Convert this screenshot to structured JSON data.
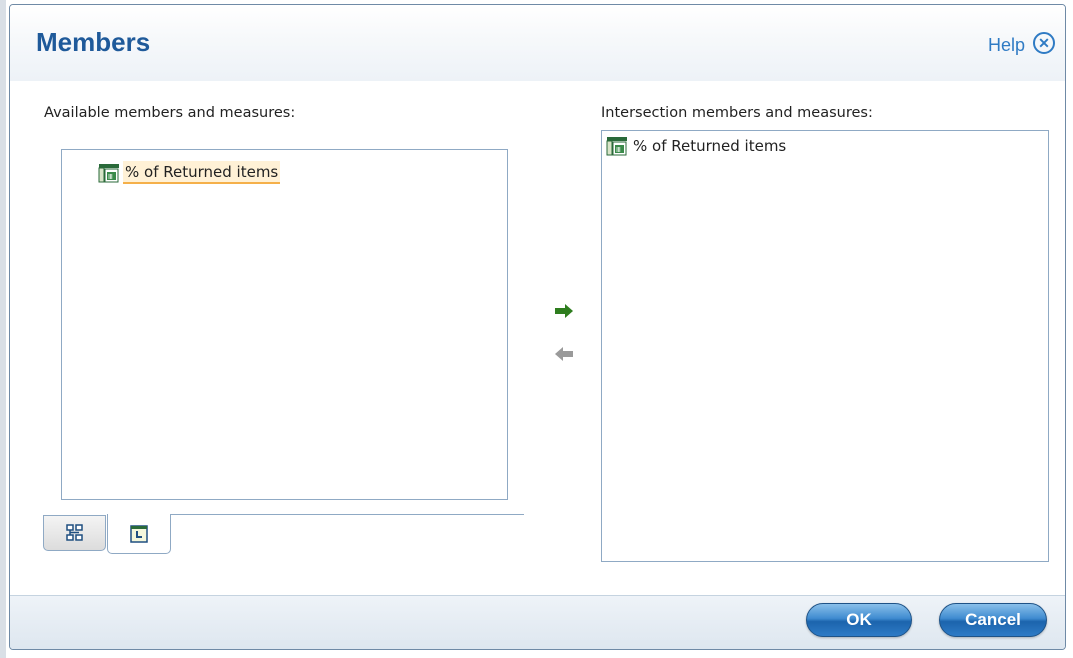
{
  "dialog": {
    "title": "Members",
    "help_label": "Help",
    "close_glyph": "✕"
  },
  "available": {
    "label": "Available members and measures:",
    "items": [
      {
        "label": "% of Returned items",
        "icon": "measure-icon",
        "selected": true
      }
    ]
  },
  "intersection": {
    "label": "Intersection members and measures:",
    "items": [
      {
        "label": "% of Returned items",
        "icon": "measure-icon"
      }
    ]
  },
  "transfer": {
    "add_icon": "arrow-right-icon",
    "remove_icon": "arrow-left-icon",
    "add_color": "#2e7d1e",
    "remove_color": "#9a9a9a"
  },
  "tabs": [
    {
      "icon": "hierarchy-icon",
      "active": false
    },
    {
      "icon": "measure-list-icon",
      "active": true
    }
  ],
  "buttons": {
    "ok_label": "OK",
    "cancel_label": "Cancel"
  },
  "colors": {
    "title": "#1f5a9a",
    "link": "#2f7bc4",
    "border": "#8fa9c4",
    "selection_bg": "#fff1d6",
    "selection_underline": "#f5b04a"
  }
}
